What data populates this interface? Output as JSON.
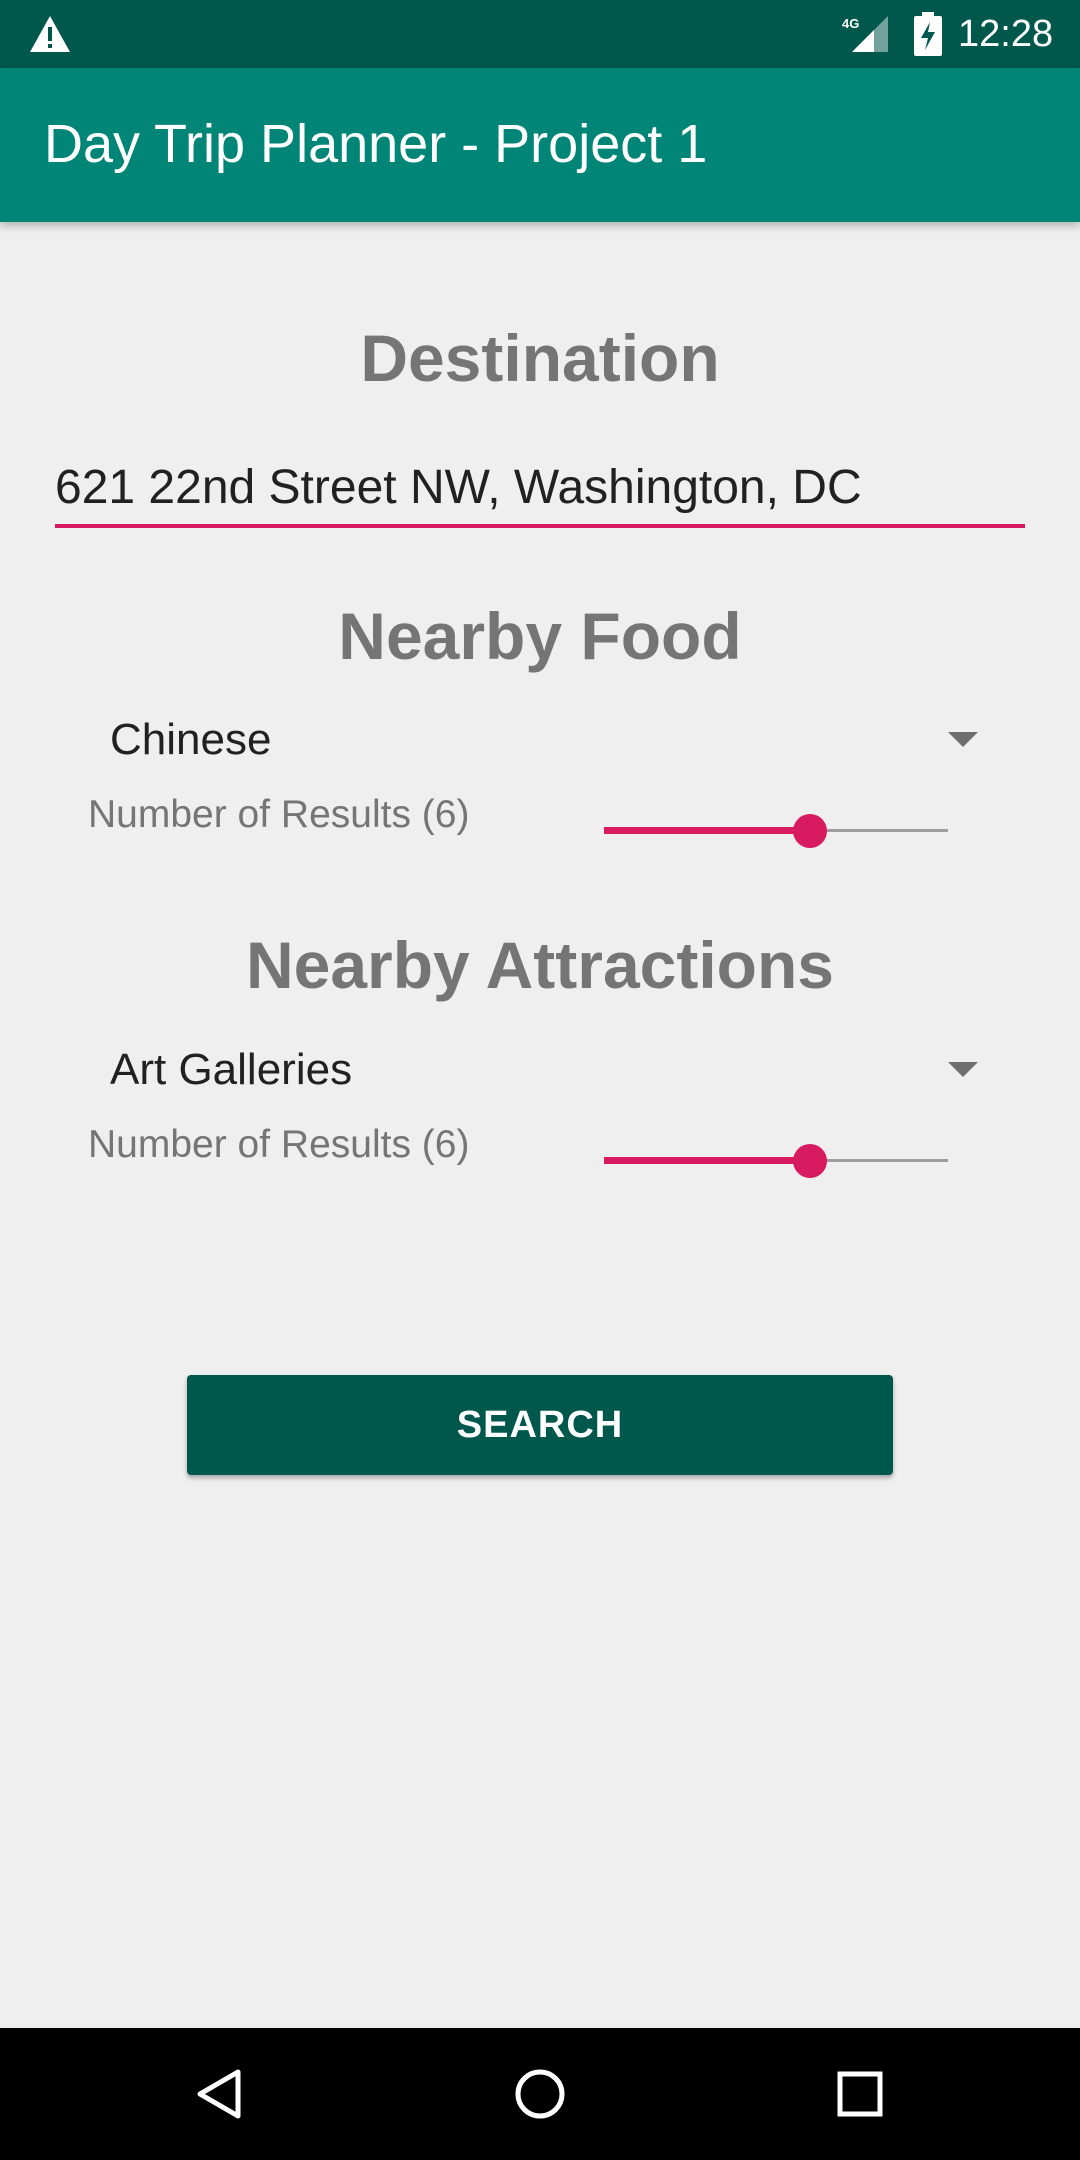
{
  "status_bar": {
    "time": "12:28",
    "network": "4G",
    "icons": [
      "warning-icon",
      "signal-icon",
      "battery-charging-icon"
    ],
    "background": "#00574b"
  },
  "app_bar": {
    "title": "Day Trip Planner - Project 1",
    "background": "#008577"
  },
  "destination": {
    "heading": "Destination",
    "address": "621 22nd Street NW, Washington, DC"
  },
  "food": {
    "heading": "Nearby Food",
    "selected": "Chinese",
    "results_label": "Number of Results (6)",
    "slider_fraction": 0.6
  },
  "attractions": {
    "heading": "Nearby Attractions",
    "selected": "Art Galleries",
    "results_label": "Number of Results (6)",
    "slider_fraction": 0.6
  },
  "search_button": {
    "label": "SEARCH"
  },
  "nav_bar": {
    "icons": [
      "back-icon",
      "home-icon",
      "recents-icon"
    ]
  },
  "colors": {
    "accent": "#d81b60",
    "primary": "#008577",
    "primary_dark": "#00574b",
    "heading_text": "#757575"
  }
}
